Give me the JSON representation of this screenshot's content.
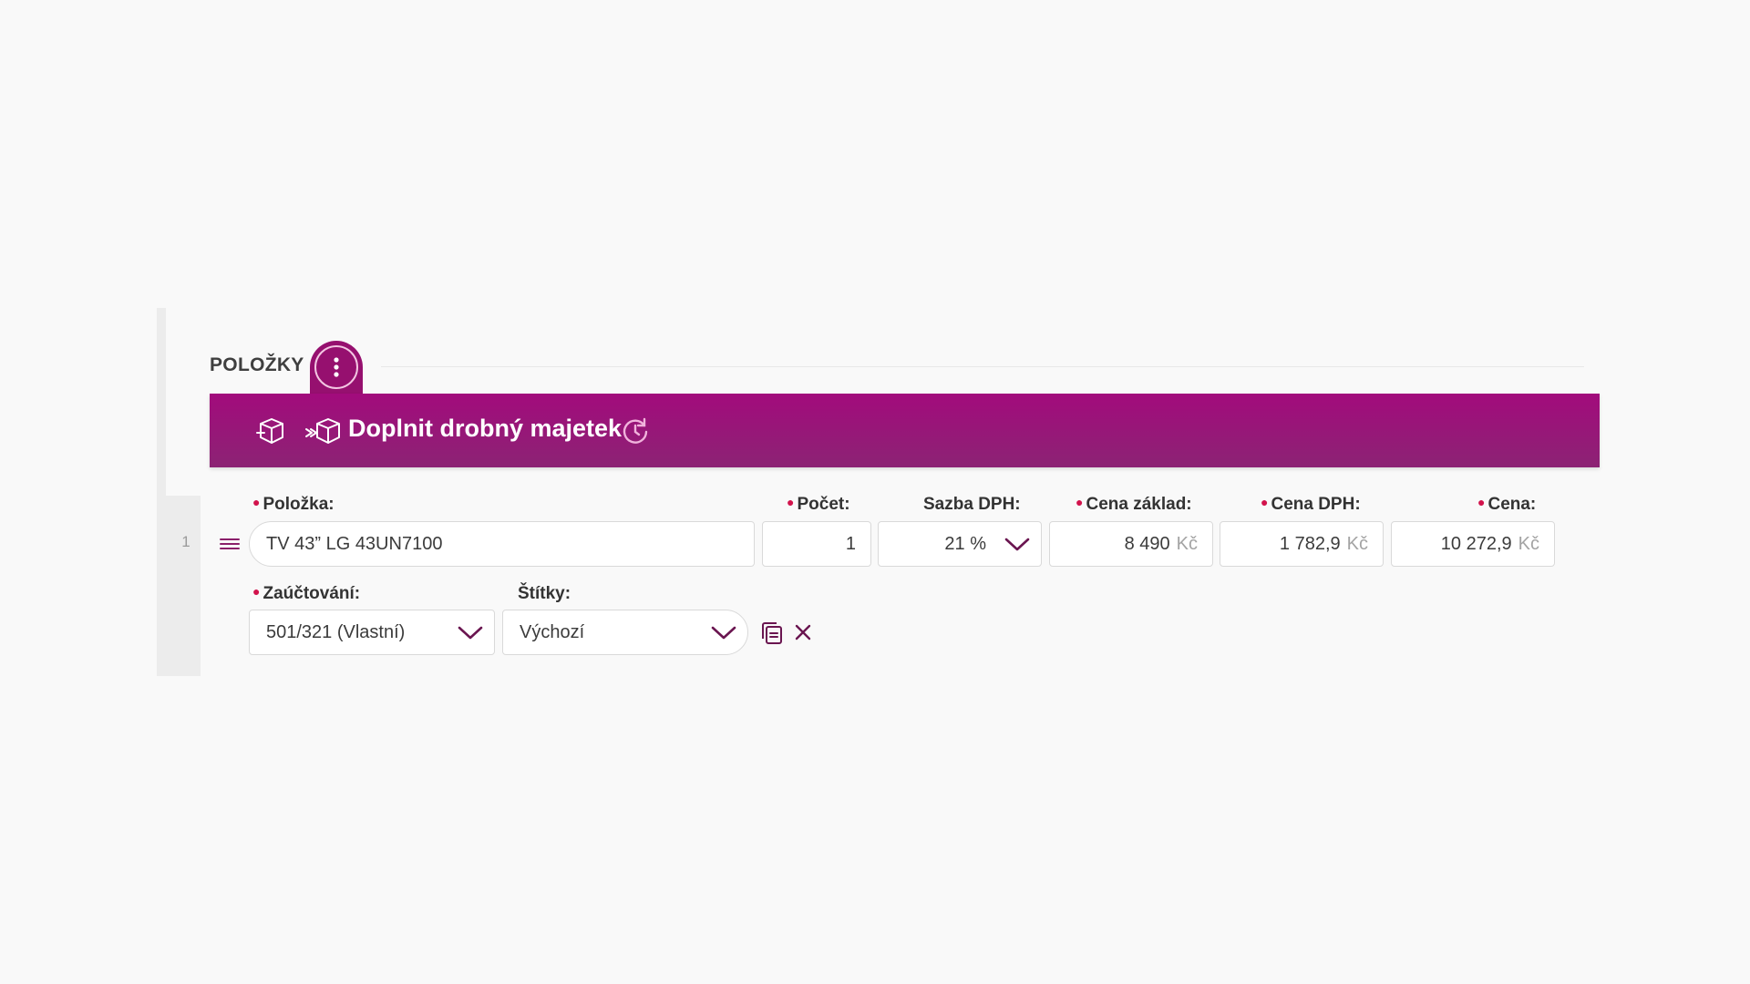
{
  "section": {
    "title": "POLOŽKY"
  },
  "banner": {
    "label": "Doplnit drobný majetek",
    "icons": [
      "box-add-icon",
      "box-move-icon",
      "history-icon"
    ]
  },
  "row": {
    "number": "1",
    "labels": {
      "item": "Položka:",
      "count": "Počet:",
      "vat_rate": "Sazba DPH:",
      "price_base": "Cena základ:",
      "price_vat": "Cena DPH:",
      "price": "Cena:",
      "accounting": "Zaúčtování:",
      "tags": "Štítky:"
    },
    "values": {
      "item": "TV 43” LG 43UN7100",
      "count": "1",
      "vat_rate": "21 %",
      "price_base": "8 490",
      "price_vat": "1 782,9",
      "price": "10 272,9",
      "currency": "Kč",
      "accounting": "501/321 (Vlastní)",
      "tags": "Výchozí"
    }
  },
  "colors": {
    "accent": "#96106f",
    "required": "#d2134c"
  }
}
